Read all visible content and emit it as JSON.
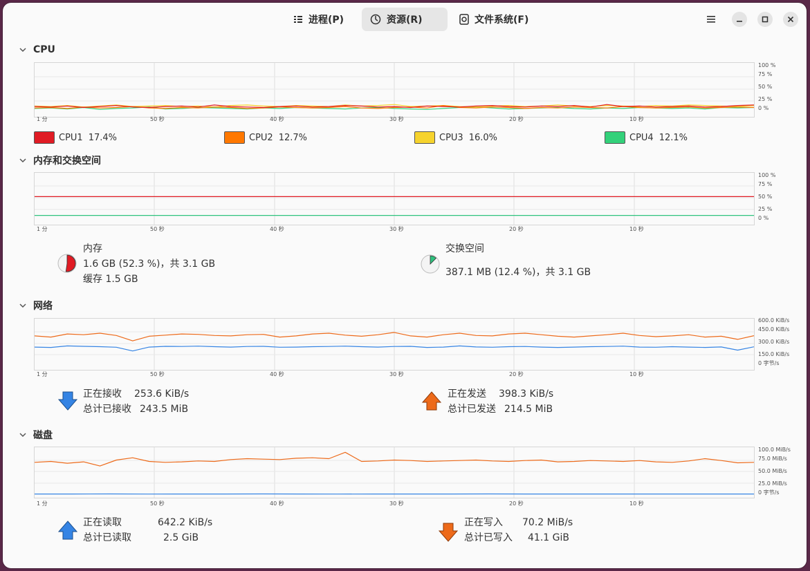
{
  "tabs": [
    {
      "label": "进程(P)",
      "icon": "list-icon",
      "active": false
    },
    {
      "label": "资源(R)",
      "icon": "gauge-icon",
      "active": true
    },
    {
      "label": "文件系统(F)",
      "icon": "disk-icon",
      "active": false
    }
  ],
  "window_controls": [
    "menu-icon",
    "minimize-icon",
    "maximize-icon",
    "close-icon"
  ],
  "x_ticks": [
    "1 分",
    "50 秒",
    "40 秒",
    "30 秒",
    "20 秒",
    "10 秒"
  ],
  "cpu": {
    "title": "CPU",
    "y_ticks": [
      "100 %",
      "75 %",
      "50 %",
      "25 %",
      "0 %"
    ],
    "legend": [
      {
        "name": "CPU1",
        "value": "17.4%",
        "color": "#e01b24"
      },
      {
        "name": "CPU2",
        "value": "12.7%",
        "color": "#ff7800"
      },
      {
        "name": "CPU3",
        "value": "16.0%",
        "color": "#f6d32d"
      },
      {
        "name": "CPU4",
        "value": "12.1%",
        "color": "#33d17a"
      }
    ]
  },
  "memory": {
    "title": "内存和交换空间",
    "y_ticks": [
      "100 %",
      "75 %",
      "50 %",
      "25 %",
      "0 %"
    ],
    "mem_label": "内存",
    "mem_line1": "1.6 GB (52.3 %)，共 3.1 GB",
    "mem_line2": "缓存 1.5 GB",
    "mem_fraction": 0.523,
    "mem_color": "#e01b24",
    "swap_label": "交换空间",
    "swap_line1": "387.1 MB (12.4 %)，共 3.1 GB",
    "swap_fraction": 0.124,
    "swap_color": "#2ec27e"
  },
  "network": {
    "title": "网络",
    "y_ticks": [
      "600.0 KiB/s",
      "450.0 KiB/s",
      "300.0 KiB/s",
      "150.0 KiB/s",
      "0 字节/s"
    ],
    "recv_label": "正在接收",
    "recv_value": "253.6 KiB/s",
    "recv_total_label": "总计已接收",
    "recv_total_value": "243.5 MiB",
    "send_label": "正在发送",
    "send_value": "398.3 KiB/s",
    "send_total_label": "总计已发送",
    "send_total_value": "214.5 MiB",
    "recv_color": "#3584e4",
    "send_color": "#ed6a1a"
  },
  "disk": {
    "title": "磁盘",
    "y_ticks": [
      "100.0 MiB/s",
      "75.0 MiB/s",
      "50.0 MiB/s",
      "25.0 MiB/s",
      "0 字节/s"
    ],
    "read_label": "正在读取",
    "read_value": "642.2 KiB/s",
    "read_total_label": "总计已读取",
    "read_total_value": "2.5 GiB",
    "write_label": "正在写入",
    "write_value": "70.2 MiB/s",
    "write_total_label": "总计已写入",
    "write_total_value": "41.1 GiB",
    "read_color": "#3584e4",
    "write_color": "#ed6a1a"
  },
  "chart_data": [
    {
      "type": "line",
      "title": "CPU",
      "ylim": [
        0,
        100
      ],
      "xlim_seconds": [
        60,
        0
      ],
      "series": [
        {
          "name": "CPU1",
          "values": [
            14,
            13,
            15,
            12,
            14,
            16,
            13,
            12,
            14,
            15,
            13,
            17,
            14,
            13,
            12,
            14,
            15,
            13,
            14,
            16,
            15,
            13,
            14,
            12,
            15,
            14,
            13,
            15,
            16,
            14,
            13,
            15,
            14,
            16,
            13,
            18,
            14,
            15,
            13,
            14,
            15,
            13,
            14,
            16,
            17
          ]
        },
        {
          "name": "CPU2",
          "values": [
            11,
            12,
            10,
            13,
            11,
            12,
            14,
            11,
            10,
            12,
            11,
            13,
            12,
            10,
            11,
            13,
            12,
            11,
            12,
            14,
            11,
            10,
            12,
            13,
            11,
            16,
            12,
            11,
            13,
            12,
            10,
            12,
            11,
            13,
            12,
            11,
            14,
            12,
            11,
            12,
            13,
            11,
            12,
            13,
            12
          ]
        },
        {
          "name": "CPU3",
          "values": [
            15,
            14,
            16,
            13,
            15,
            17,
            14,
            15,
            16,
            14,
            15,
            13,
            16,
            17,
            15,
            14,
            16,
            15,
            14,
            17,
            15,
            16,
            18,
            14,
            15,
            16,
            14,
            13,
            15,
            16,
            14,
            15,
            17,
            15,
            14,
            16,
            15,
            14,
            16,
            15,
            17,
            16,
            15,
            14,
            16
          ]
        },
        {
          "name": "CPU4",
          "values": [
            10,
            11,
            9,
            12,
            8,
            10,
            11,
            13,
            9,
            10,
            12,
            11,
            10,
            9,
            11,
            10,
            12,
            11,
            10,
            9,
            11,
            12,
            10,
            9,
            8,
            10,
            12,
            13,
            11,
            9,
            10,
            11,
            12,
            10,
            9,
            11,
            10,
            12,
            11,
            10,
            11,
            9,
            12,
            11,
            12
          ]
        }
      ]
    },
    {
      "type": "line",
      "title": "内存和交换空间",
      "ylim": [
        0,
        100
      ],
      "series": [
        {
          "name": "内存",
          "values": [
            52.3,
            52.3
          ]
        },
        {
          "name": "交换空间",
          "values": [
            12.4,
            12.4
          ]
        }
      ]
    },
    {
      "type": "line",
      "title": "网络",
      "ylim": [
        0,
        600
      ],
      "series": [
        {
          "name": "正在接收",
          "values": [
            250,
            245,
            265,
            260,
            255,
            248,
            200,
            250,
            260,
            258,
            262,
            255,
            250,
            258,
            260,
            248,
            250,
            255,
            258,
            262,
            255,
            250,
            258,
            260,
            245,
            250,
            265,
            252,
            248,
            255,
            258,
            250,
            245,
            250,
            255,
            258,
            262,
            250,
            248,
            255,
            250,
            245,
            252,
            210,
            253
          ]
        },
        {
          "name": "正在发送",
          "values": [
            395,
            380,
            420,
            410,
            430,
            400,
            330,
            390,
            405,
            420,
            415,
            400,
            395,
            410,
            415,
            380,
            395,
            420,
            430,
            405,
            390,
            410,
            440,
            395,
            380,
            410,
            430,
            400,
            395,
            420,
            430,
            410,
            390,
            380,
            395,
            410,
            430,
            400,
            385,
            395,
            410,
            380,
            390,
            350,
            398
          ]
        }
      ]
    },
    {
      "type": "line",
      "title": "磁盘",
      "ylim": [
        0,
        100
      ],
      "series": [
        {
          "name": "正在读取",
          "values": [
            0.6,
            0.6,
            0.7,
            0.5,
            0.6,
            0.6,
            0.7,
            0.6,
            0.5,
            0.6,
            0.6,
            0.6,
            0.7,
            0.6,
            0.6,
            0.6,
            0.6,
            0.6,
            0.6,
            0.6
          ]
        },
        {
          "name": "正在写入",
          "values": [
            70,
            72,
            68,
            71,
            62,
            75,
            80,
            72,
            70,
            71,
            73,
            72,
            76,
            78,
            77,
            76,
            79,
            80,
            78,
            92,
            72,
            73,
            75,
            74,
            72,
            73,
            74,
            75,
            73,
            72,
            74,
            75,
            71,
            72,
            74,
            73,
            72,
            74,
            71,
            70,
            73,
            78,
            74,
            69,
            70
          ]
        }
      ]
    }
  ]
}
